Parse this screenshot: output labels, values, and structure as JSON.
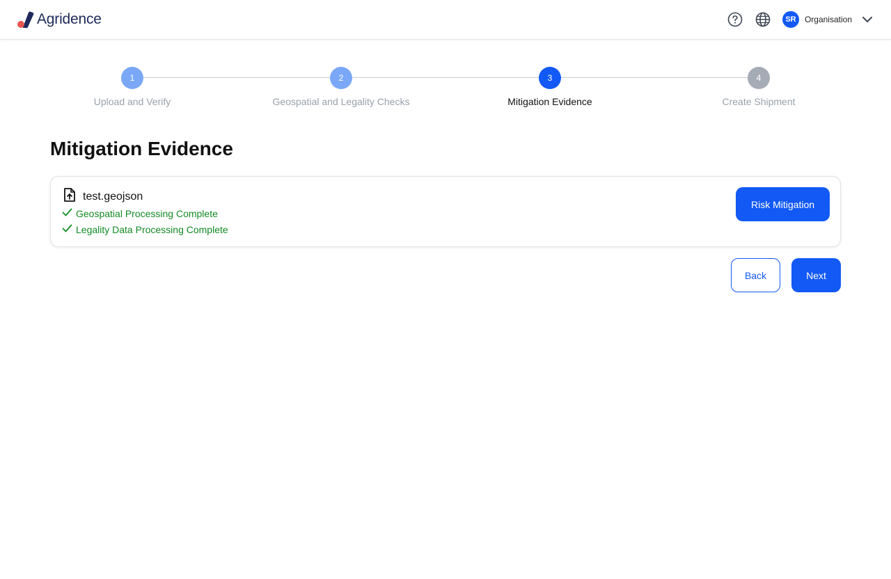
{
  "header": {
    "brand": "Agridence",
    "avatar_initials": "SR",
    "org_label": "Organisation",
    "icons": [
      "help-icon",
      "globe-icon",
      "chevron-down-icon"
    ]
  },
  "stepper": {
    "steps": [
      {
        "number": "1",
        "label": "Upload and Verify",
        "state": "complete",
        "color": "#7aa8f7"
      },
      {
        "number": "2",
        "label": "Geospatial and Legality Checks",
        "state": "complete",
        "color": "#7aa8f7"
      },
      {
        "number": "3",
        "label": "Mitigation Evidence",
        "state": "active",
        "color": "#1259f5"
      },
      {
        "number": "4",
        "label": "Create Shipment",
        "state": "pending",
        "color": "#a6acb6"
      }
    ]
  },
  "main": {
    "title": "Mitigation Evidence",
    "file": {
      "name": "test.geojson",
      "checks": [
        "Geospatial Processing Complete",
        "Legality Data Processing Complete"
      ]
    },
    "risk_button": "Risk Mitigation",
    "back_button": "Back",
    "next_button": "Next"
  },
  "colors": {
    "primary": "#1259f5",
    "success": "#128a24",
    "muted": "#9aa1ab"
  }
}
